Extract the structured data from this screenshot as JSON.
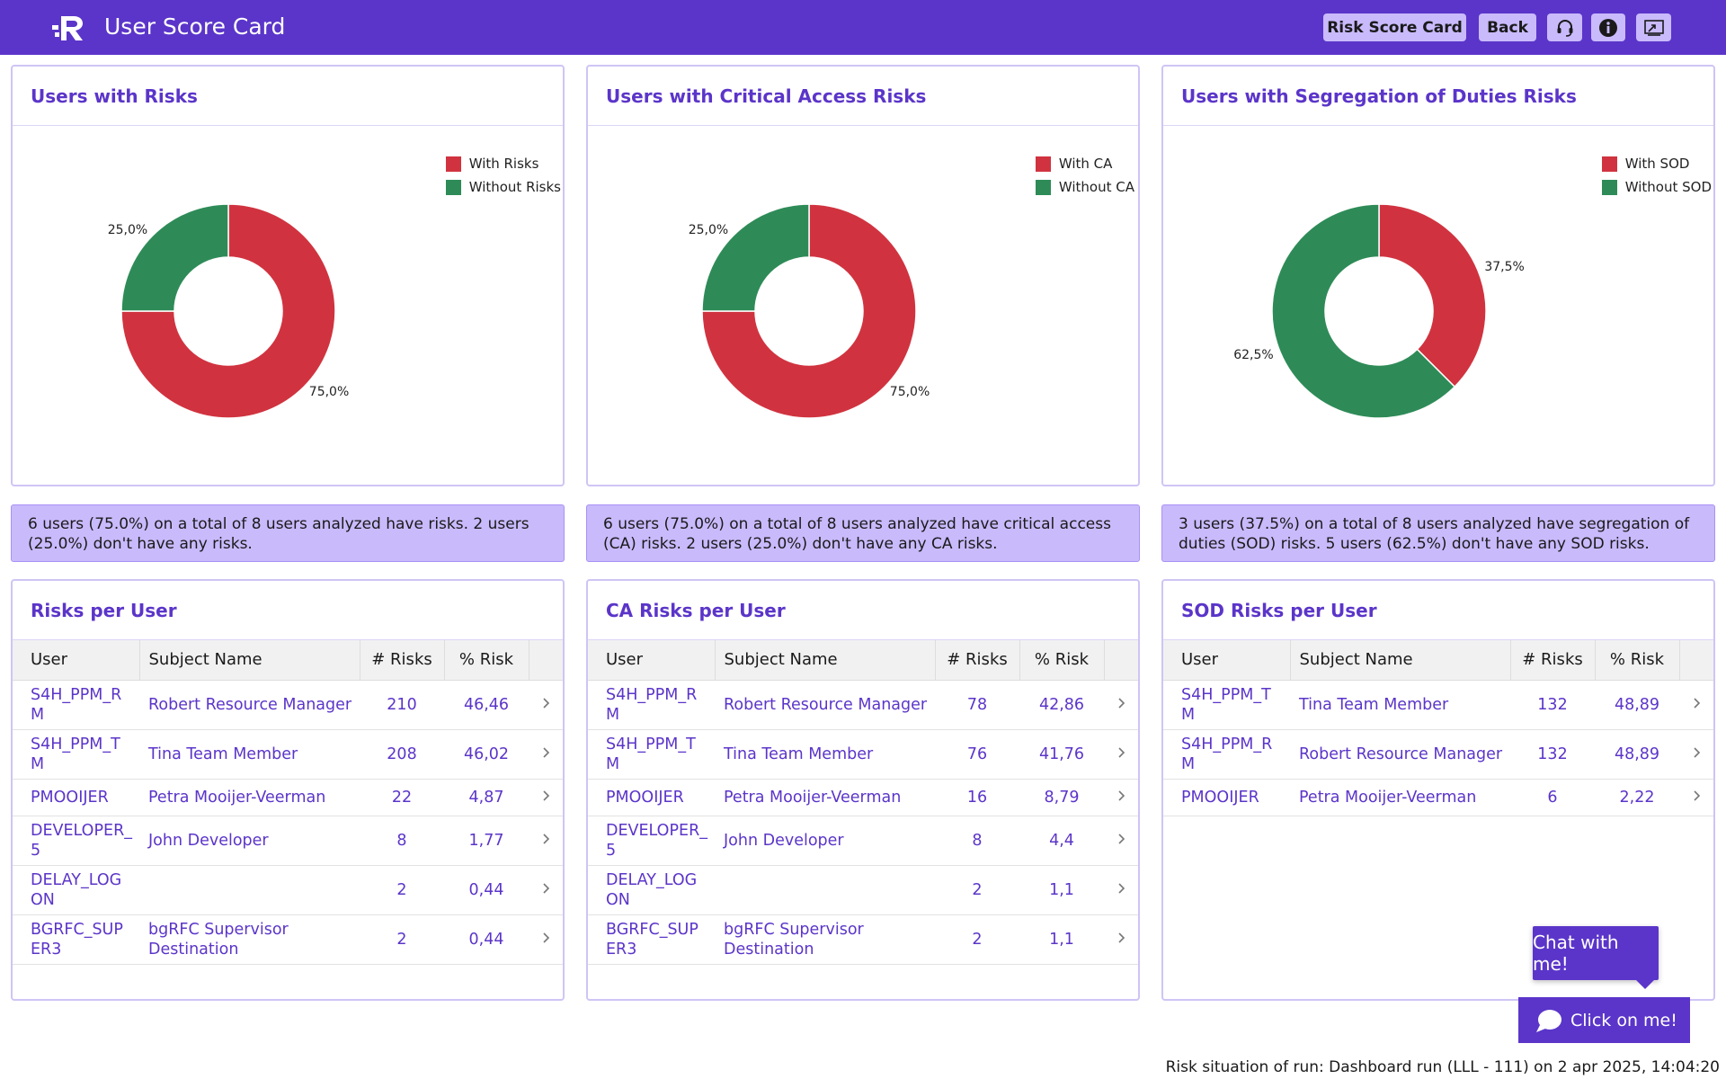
{
  "header": {
    "title": "User Score Card",
    "buttons": {
      "risk_score_card": "Risk Score Card",
      "back": "Back"
    }
  },
  "colors": {
    "brand": "#5b35c9",
    "accent_light": "#c9bafc",
    "risk_red": "#d0333f",
    "ok_green": "#2e8b57"
  },
  "charts": [
    {
      "title": "Users with Risks",
      "legend": [
        "With Risks",
        "Without Risks"
      ],
      "labels": [
        "75,0%",
        "25,0%"
      ],
      "summary": "6 users (75.0%) on a total of 8 users analyzed have risks. 2 users (25.0%) don't have any risks."
    },
    {
      "title": "Users with Critical Access Risks",
      "legend": [
        "With CA",
        "Without CA"
      ],
      "labels": [
        "75,0%",
        "25,0%"
      ],
      "summary": "6 users (75.0%) on a total of 8 users analyzed have critical access (CA) risks. 2 users (25.0%) don't have any CA risks."
    },
    {
      "title": "Users with Segregation of Duties Risks",
      "legend": [
        "With SOD",
        "Without SOD"
      ],
      "labels": [
        "37,5%",
        "62,5%"
      ],
      "summary": "3 users (37.5%) on a total of 8 users analyzed have segregation of duties (SOD) risks. 5 users (62.5%) don't have any SOD risks."
    }
  ],
  "chart_data": [
    {
      "type": "pie",
      "title": "Users with Risks",
      "categories": [
        "With Risks",
        "Without Risks"
      ],
      "values": [
        75.0,
        25.0
      ],
      "donut": true,
      "legend": "top-right"
    },
    {
      "type": "pie",
      "title": "Users with Critical Access Risks",
      "categories": [
        "With CA",
        "Without CA"
      ],
      "values": [
        75.0,
        25.0
      ],
      "donut": true,
      "legend": "top-right"
    },
    {
      "type": "pie",
      "title": "Users with Segregation of Duties Risks",
      "categories": [
        "With SOD",
        "Without SOD"
      ],
      "values": [
        37.5,
        62.5
      ],
      "donut": true,
      "legend": "top-right"
    }
  ],
  "tables": [
    {
      "title": "Risks per User",
      "columns": [
        "User",
        "Subject Name",
        "# Risks",
        "% Risk"
      ],
      "rows": [
        {
          "user": "S4H_PPM_RM",
          "name": "Robert Resource Manager",
          "risks": "210",
          "pct": "46,46"
        },
        {
          "user": "S4H_PPM_TM",
          "name": "Tina Team Member",
          "risks": "208",
          "pct": "46,02"
        },
        {
          "user": "PMOOIJER",
          "name": "Petra Mooijer-Veerman",
          "risks": "22",
          "pct": "4,87"
        },
        {
          "user": "DEVELOPER_5",
          "name": "John Developer",
          "risks": "8",
          "pct": "1,77"
        },
        {
          "user": "DELAY_LOGON",
          "name": "",
          "risks": "2",
          "pct": "0,44"
        },
        {
          "user": "BGRFC_SUPER3",
          "name": "bgRFC Supervisor Destination",
          "risks": "2",
          "pct": "0,44"
        }
      ]
    },
    {
      "title": "CA Risks per User",
      "columns": [
        "User",
        "Subject Name",
        "# Risks",
        "% Risk"
      ],
      "rows": [
        {
          "user": "S4H_PPM_RM",
          "name": "Robert Resource Manager",
          "risks": "78",
          "pct": "42,86"
        },
        {
          "user": "S4H_PPM_TM",
          "name": "Tina Team Member",
          "risks": "76",
          "pct": "41,76"
        },
        {
          "user": "PMOOIJER",
          "name": "Petra Mooijer-Veerman",
          "risks": "16",
          "pct": "8,79"
        },
        {
          "user": "DEVELOPER_5",
          "name": "John Developer",
          "risks": "8",
          "pct": "4,4"
        },
        {
          "user": "DELAY_LOGON",
          "name": "",
          "risks": "2",
          "pct": "1,1"
        },
        {
          "user": "BGRFC_SUPER3",
          "name": "bgRFC Supervisor Destination",
          "risks": "2",
          "pct": "1,1"
        }
      ]
    },
    {
      "title": "SOD Risks per User",
      "columns": [
        "User",
        "Subject Name",
        "# Risks",
        "% Risk"
      ],
      "rows": [
        {
          "user": "S4H_PPM_TM",
          "name": "Tina Team Member",
          "risks": "132",
          "pct": "48,89"
        },
        {
          "user": "S4H_PPM_RM",
          "name": "Robert Resource Manager",
          "risks": "132",
          "pct": "48,89"
        },
        {
          "user": "PMOOIJER",
          "name": "Petra Mooijer-Veerman",
          "risks": "6",
          "pct": "2,22"
        }
      ]
    }
  ],
  "chat": {
    "bubble": "Chat with me!",
    "button": "Click on me!"
  },
  "footer": "Risk situation of run: Dashboard run (LLL - 111) on 2 apr 2025, 14:04:20"
}
